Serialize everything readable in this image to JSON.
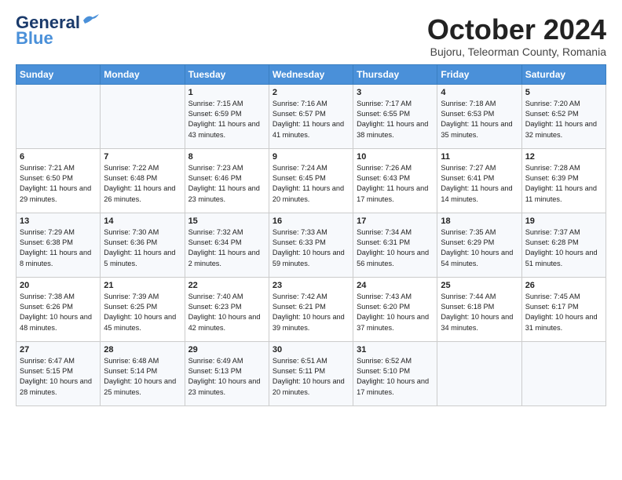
{
  "header": {
    "logo_line1": "General",
    "logo_line2": "Blue",
    "month": "October 2024",
    "location": "Bujoru, Teleorman County, Romania"
  },
  "days_of_week": [
    "Sunday",
    "Monday",
    "Tuesday",
    "Wednesday",
    "Thursday",
    "Friday",
    "Saturday"
  ],
  "weeks": [
    [
      {
        "num": "",
        "detail": ""
      },
      {
        "num": "",
        "detail": ""
      },
      {
        "num": "1",
        "detail": "Sunrise: 7:15 AM\nSunset: 6:59 PM\nDaylight: 11 hours and 43 minutes."
      },
      {
        "num": "2",
        "detail": "Sunrise: 7:16 AM\nSunset: 6:57 PM\nDaylight: 11 hours and 41 minutes."
      },
      {
        "num": "3",
        "detail": "Sunrise: 7:17 AM\nSunset: 6:55 PM\nDaylight: 11 hours and 38 minutes."
      },
      {
        "num": "4",
        "detail": "Sunrise: 7:18 AM\nSunset: 6:53 PM\nDaylight: 11 hours and 35 minutes."
      },
      {
        "num": "5",
        "detail": "Sunrise: 7:20 AM\nSunset: 6:52 PM\nDaylight: 11 hours and 32 minutes."
      }
    ],
    [
      {
        "num": "6",
        "detail": "Sunrise: 7:21 AM\nSunset: 6:50 PM\nDaylight: 11 hours and 29 minutes."
      },
      {
        "num": "7",
        "detail": "Sunrise: 7:22 AM\nSunset: 6:48 PM\nDaylight: 11 hours and 26 minutes."
      },
      {
        "num": "8",
        "detail": "Sunrise: 7:23 AM\nSunset: 6:46 PM\nDaylight: 11 hours and 23 minutes."
      },
      {
        "num": "9",
        "detail": "Sunrise: 7:24 AM\nSunset: 6:45 PM\nDaylight: 11 hours and 20 minutes."
      },
      {
        "num": "10",
        "detail": "Sunrise: 7:26 AM\nSunset: 6:43 PM\nDaylight: 11 hours and 17 minutes."
      },
      {
        "num": "11",
        "detail": "Sunrise: 7:27 AM\nSunset: 6:41 PM\nDaylight: 11 hours and 14 minutes."
      },
      {
        "num": "12",
        "detail": "Sunrise: 7:28 AM\nSunset: 6:39 PM\nDaylight: 11 hours and 11 minutes."
      }
    ],
    [
      {
        "num": "13",
        "detail": "Sunrise: 7:29 AM\nSunset: 6:38 PM\nDaylight: 11 hours and 8 minutes."
      },
      {
        "num": "14",
        "detail": "Sunrise: 7:30 AM\nSunset: 6:36 PM\nDaylight: 11 hours and 5 minutes."
      },
      {
        "num": "15",
        "detail": "Sunrise: 7:32 AM\nSunset: 6:34 PM\nDaylight: 11 hours and 2 minutes."
      },
      {
        "num": "16",
        "detail": "Sunrise: 7:33 AM\nSunset: 6:33 PM\nDaylight: 10 hours and 59 minutes."
      },
      {
        "num": "17",
        "detail": "Sunrise: 7:34 AM\nSunset: 6:31 PM\nDaylight: 10 hours and 56 minutes."
      },
      {
        "num": "18",
        "detail": "Sunrise: 7:35 AM\nSunset: 6:29 PM\nDaylight: 10 hours and 54 minutes."
      },
      {
        "num": "19",
        "detail": "Sunrise: 7:37 AM\nSunset: 6:28 PM\nDaylight: 10 hours and 51 minutes."
      }
    ],
    [
      {
        "num": "20",
        "detail": "Sunrise: 7:38 AM\nSunset: 6:26 PM\nDaylight: 10 hours and 48 minutes."
      },
      {
        "num": "21",
        "detail": "Sunrise: 7:39 AM\nSunset: 6:25 PM\nDaylight: 10 hours and 45 minutes."
      },
      {
        "num": "22",
        "detail": "Sunrise: 7:40 AM\nSunset: 6:23 PM\nDaylight: 10 hours and 42 minutes."
      },
      {
        "num": "23",
        "detail": "Sunrise: 7:42 AM\nSunset: 6:21 PM\nDaylight: 10 hours and 39 minutes."
      },
      {
        "num": "24",
        "detail": "Sunrise: 7:43 AM\nSunset: 6:20 PM\nDaylight: 10 hours and 37 minutes."
      },
      {
        "num": "25",
        "detail": "Sunrise: 7:44 AM\nSunset: 6:18 PM\nDaylight: 10 hours and 34 minutes."
      },
      {
        "num": "26",
        "detail": "Sunrise: 7:45 AM\nSunset: 6:17 PM\nDaylight: 10 hours and 31 minutes."
      }
    ],
    [
      {
        "num": "27",
        "detail": "Sunrise: 6:47 AM\nSunset: 5:15 PM\nDaylight: 10 hours and 28 minutes."
      },
      {
        "num": "28",
        "detail": "Sunrise: 6:48 AM\nSunset: 5:14 PM\nDaylight: 10 hours and 25 minutes."
      },
      {
        "num": "29",
        "detail": "Sunrise: 6:49 AM\nSunset: 5:13 PM\nDaylight: 10 hours and 23 minutes."
      },
      {
        "num": "30",
        "detail": "Sunrise: 6:51 AM\nSunset: 5:11 PM\nDaylight: 10 hours and 20 minutes."
      },
      {
        "num": "31",
        "detail": "Sunrise: 6:52 AM\nSunset: 5:10 PM\nDaylight: 10 hours and 17 minutes."
      },
      {
        "num": "",
        "detail": ""
      },
      {
        "num": "",
        "detail": ""
      }
    ]
  ]
}
